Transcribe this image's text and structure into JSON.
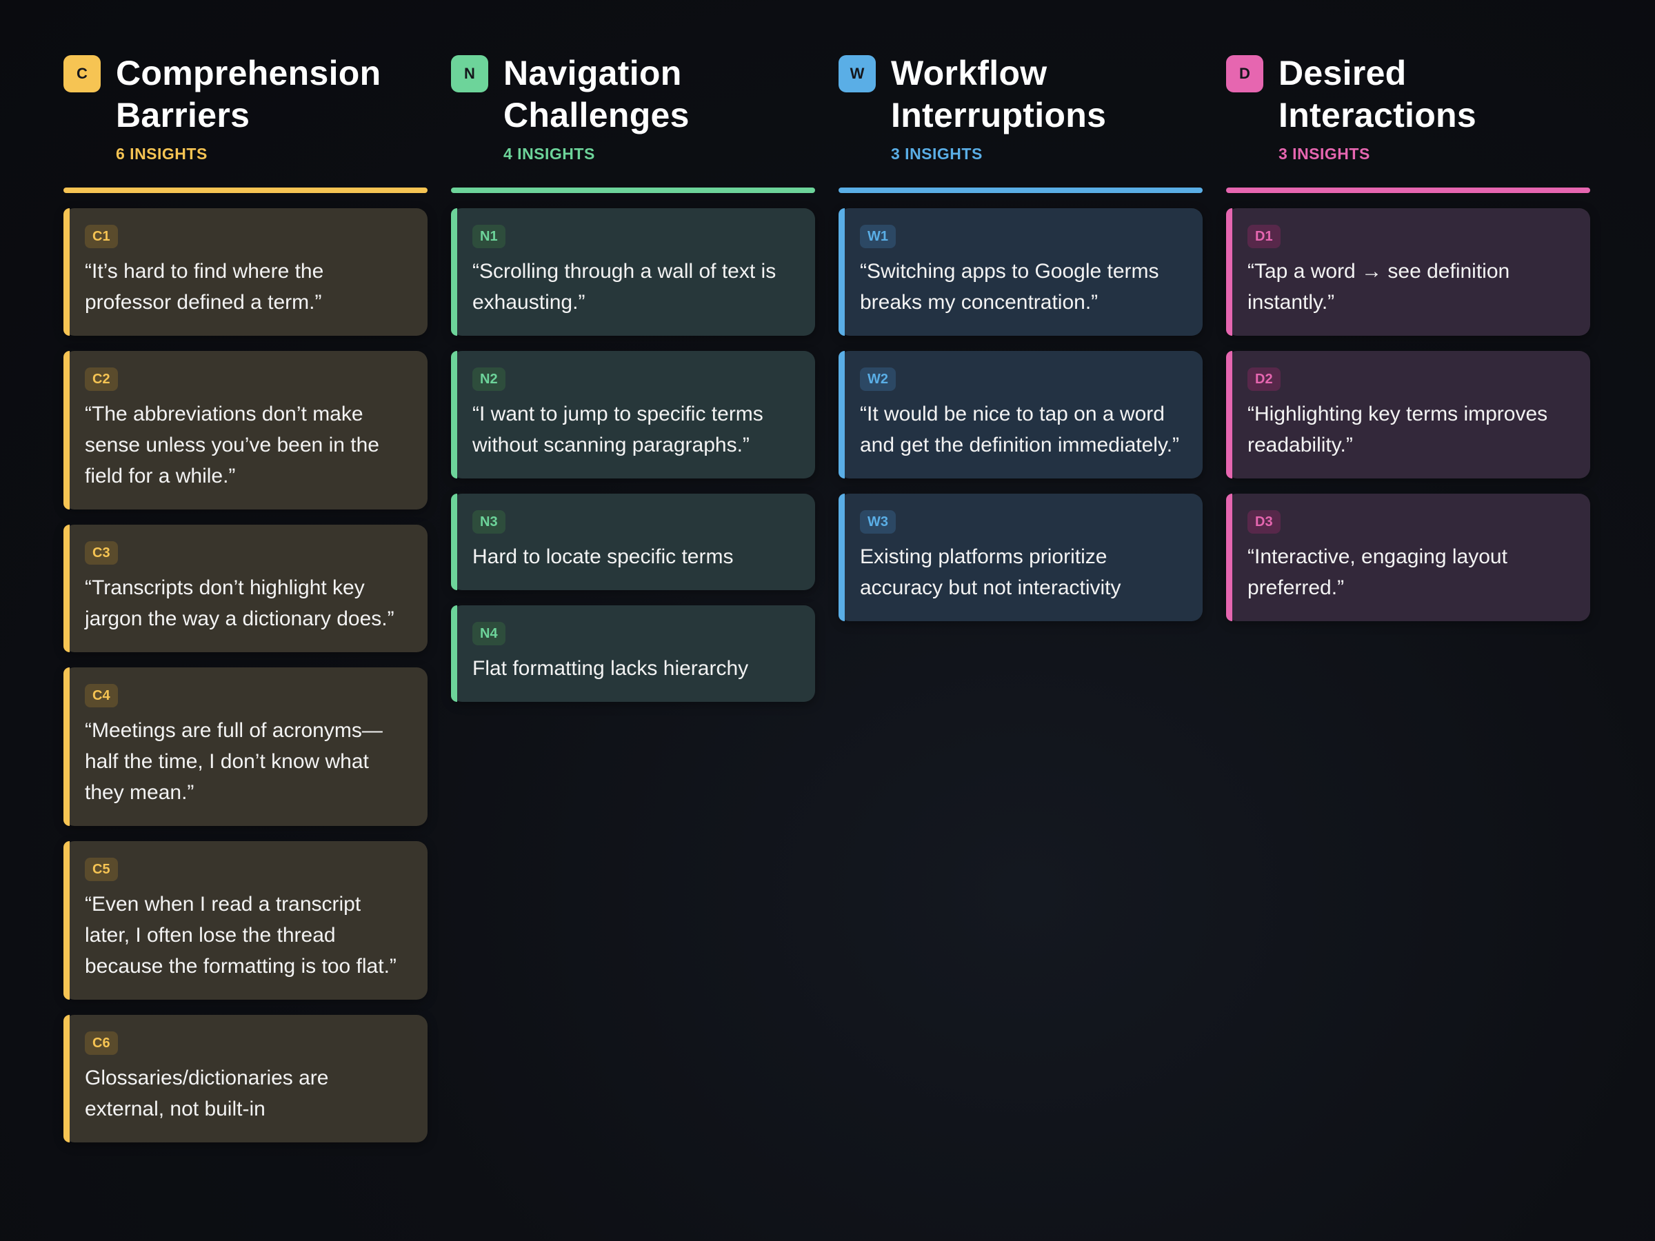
{
  "columns": [
    {
      "key": "c",
      "badge": "C",
      "title_line1": "Comprehension",
      "title_line2": "Barriers",
      "count": "6 INSIGHTS",
      "color": "#f6c453",
      "cards": [
        {
          "tag": "C1",
          "text": "“It’s hard to find where the professor defined a term.”"
        },
        {
          "tag": "C2",
          "text": "“The abbreviations don’t make sense unless you’ve been in the field for a while.”"
        },
        {
          "tag": "C3",
          "text": "“Transcripts don’t highlight key jargon the way a dictionary does.”"
        },
        {
          "tag": "C4",
          "text": "“Meetings are full of acronyms—half the time, I don’t know what they mean.”"
        },
        {
          "tag": "C5",
          "text": "“Even when I read a transcript later, I often lose the thread because the formatting is too flat.”"
        },
        {
          "tag": "C6",
          "text": "Glossaries/dictionaries are external, not built-in"
        }
      ]
    },
    {
      "key": "n",
      "badge": "N",
      "title_line1": "Navigation",
      "title_line2": "Challenges",
      "count": "4 INSIGHTS",
      "color": "#6dd49a",
      "cards": [
        {
          "tag": "N1",
          "text": "“Scrolling through a wall of text is exhausting.”"
        },
        {
          "tag": "N2",
          "text": "“I want to jump to specific terms without scanning paragraphs.”"
        },
        {
          "tag": "N3",
          "text": "Hard to locate specific terms"
        },
        {
          "tag": "N4",
          "text": "Flat formatting lacks hierarchy"
        }
      ]
    },
    {
      "key": "w",
      "badge": "W",
      "title_line1": "Workflow",
      "title_line2": "Interruptions",
      "count": "3 INSIGHTS",
      "color": "#5aaee6",
      "cards": [
        {
          "tag": "W1",
          "text": "“Switching apps to Google terms breaks my concentration.”"
        },
        {
          "tag": "W2",
          "text": "“It would be nice to tap on a word and get the definition immediately.”"
        },
        {
          "tag": "W3",
          "text": "Existing platforms prioritize accuracy but not interactivity"
        }
      ]
    },
    {
      "key": "d",
      "badge": "D",
      "title_line1": "Desired",
      "title_line2": "Interactions",
      "count": "3 INSIGHTS",
      "color": "#e666b0",
      "cards": [
        {
          "tag": "D1",
          "text": "“Tap a word → see definition instantly.”"
        },
        {
          "tag": "D2",
          "text": "“Highlighting key terms improves readability.”"
        },
        {
          "tag": "D3",
          "text": "“Interactive, engaging layout preferred.”"
        }
      ]
    }
  ]
}
